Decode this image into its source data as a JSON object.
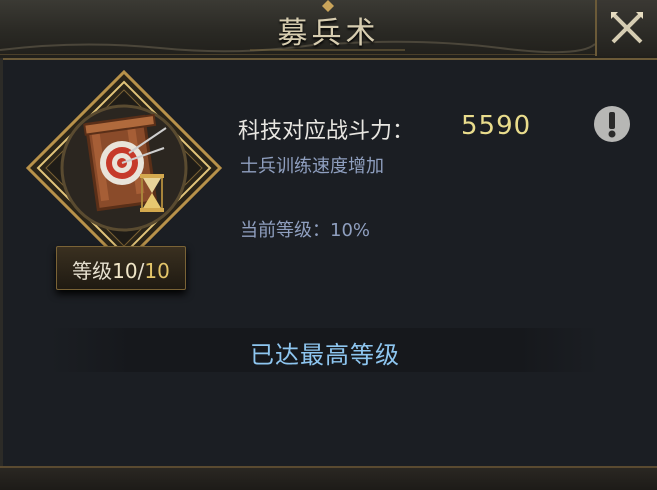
{
  "header": {
    "title": "募兵术"
  },
  "tech": {
    "icon": "archery-target-icon",
    "level_label": "等级",
    "level_current": "10",
    "level_separator": "/",
    "level_max": "10",
    "power_label": "科技对应战斗力：",
    "power_value": "5590",
    "description": "士兵训练速度增加",
    "current_level_text": "当前等级：10%"
  },
  "status": {
    "max_level_text": "已达最高等级"
  },
  "colors": {
    "power_value": "#e9dc8c",
    "max_text": "#8ec6f0",
    "desc": "#8f9fbf",
    "frame_gold": "#b8924a"
  }
}
